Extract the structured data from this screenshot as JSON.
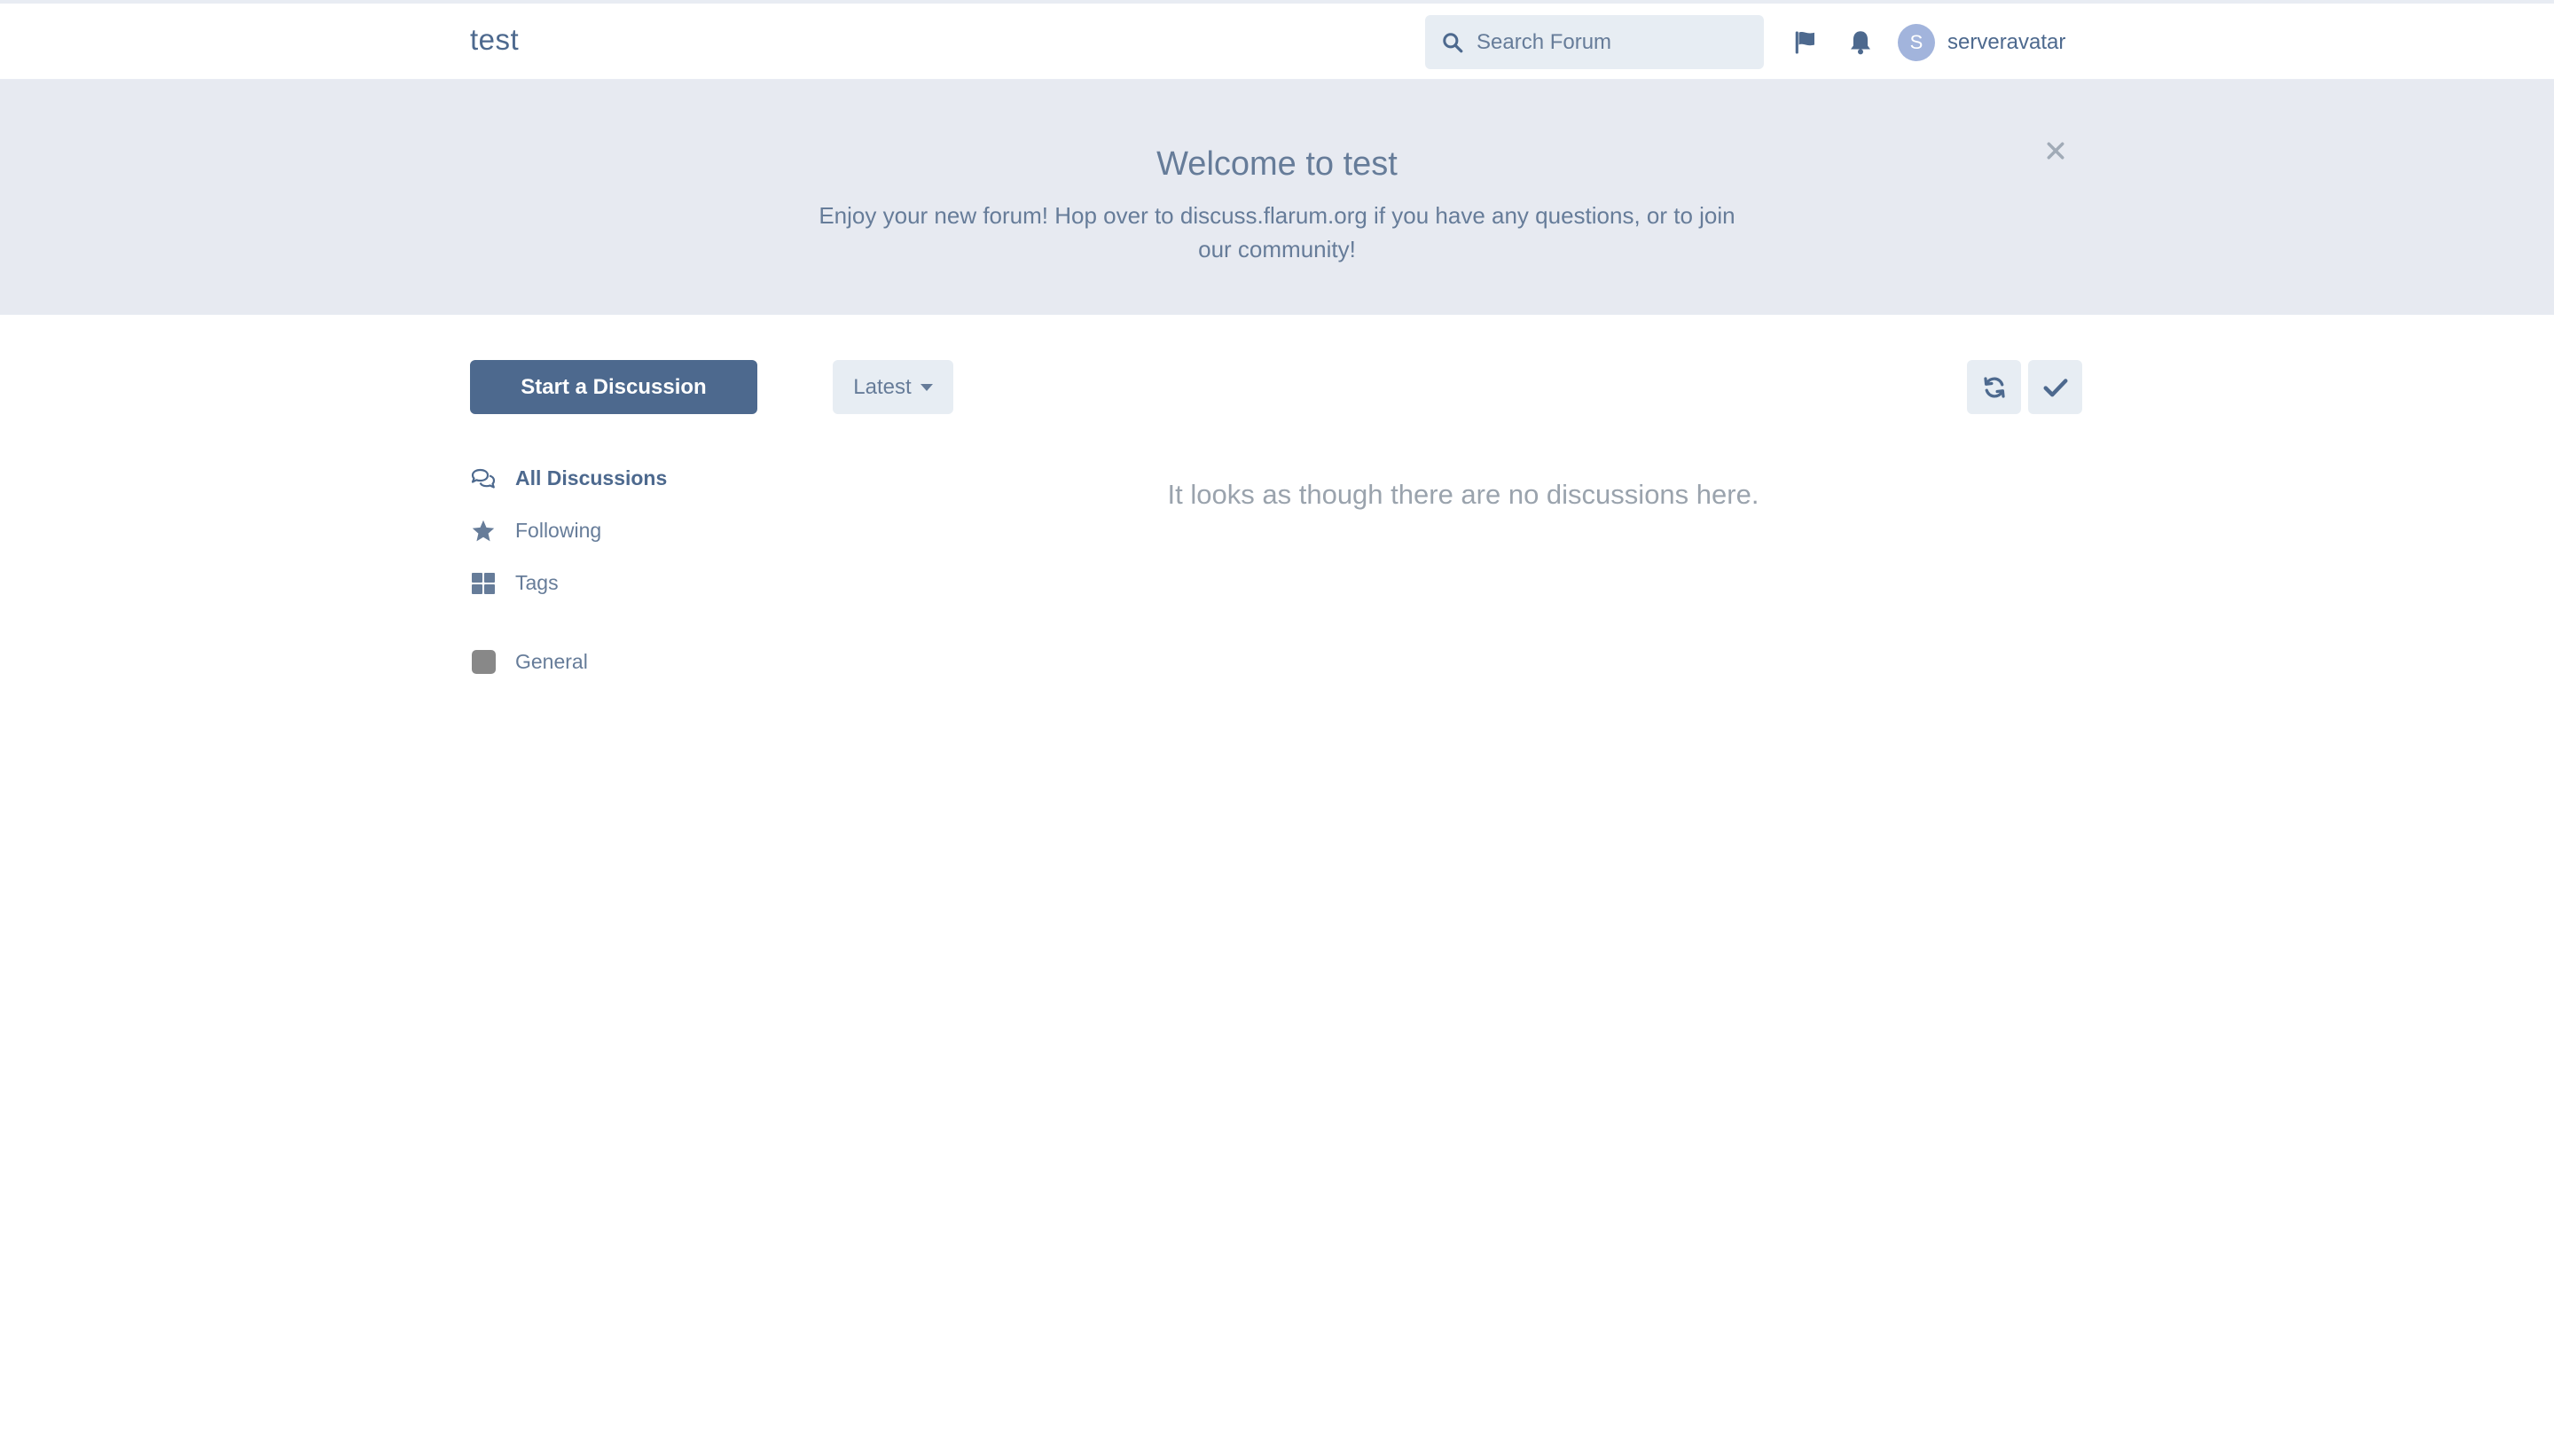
{
  "header": {
    "brand": "test",
    "search_placeholder": "Search Forum",
    "user": {
      "avatar_letter": "S",
      "name": "serveravatar"
    }
  },
  "hero": {
    "title": "Welcome to test",
    "text": "Enjoy your new forum! Hop over to discuss.flarum.org if you have any questions, or to join our community!"
  },
  "sidebar": {
    "start_button": "Start a Discussion",
    "nav": [
      {
        "label": "All Discussions",
        "icon": "comments-icon",
        "active": true
      },
      {
        "label": "Following",
        "icon": "star-icon",
        "active": false
      },
      {
        "label": "Tags",
        "icon": "tags-grid-icon",
        "active": false
      }
    ],
    "tags": [
      {
        "label": "General",
        "color": "#888888"
      }
    ]
  },
  "toolbar": {
    "sort_label": "Latest",
    "refresh_icon": "refresh-icon",
    "mark_read_icon": "check-icon"
  },
  "main": {
    "empty_text": "It looks as though there are no discussions here."
  },
  "colors": {
    "primary": "#4d698e",
    "hero_bg": "#e7eaf1",
    "control_bg": "#e7edf3",
    "text": "#667c99",
    "muted": "#9aa3ad"
  }
}
